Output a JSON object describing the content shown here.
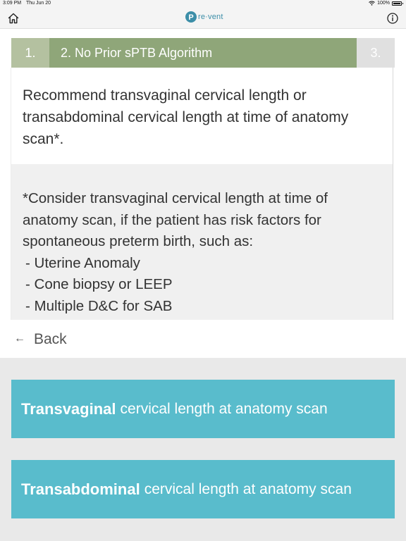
{
  "status_bar": {
    "time": "3:09 PM",
    "date": "Thu Jun 20",
    "battery": "100%"
  },
  "nav": {
    "logo_text": "re·vent",
    "logo_letter": "P",
    "brand_color": "#3c8ea8"
  },
  "steps": {
    "step1": "1.",
    "step2": "2. No Prior sPTB Algorithm",
    "step3": "3."
  },
  "content": {
    "recommendation": "Recommend transvaginal cervical length or transabdominal cervical length at time of anatomy scan*.",
    "note_intro": "*Consider transvaginal cervical length at time of anatomy scan, if the patient has risk factors for spontaneous preterm birth, such as:",
    "risk_factors": [
      "- Uterine Anomaly",
      "- Cone biopsy or LEEP",
      "- Multiple D&C for SAB"
    ]
  },
  "back": {
    "label": "Back"
  },
  "choices": [
    {
      "bold": "Transvaginal",
      "rest": "cervical length at anatomy scan"
    },
    {
      "bold": "Transabdominal",
      "rest": "cervical length at anatomy scan"
    }
  ],
  "colors": {
    "step_active": "#8fa679",
    "step_done": "#b4c1a0",
    "step_next": "#e0e0e0",
    "choice": "#59bccc"
  }
}
